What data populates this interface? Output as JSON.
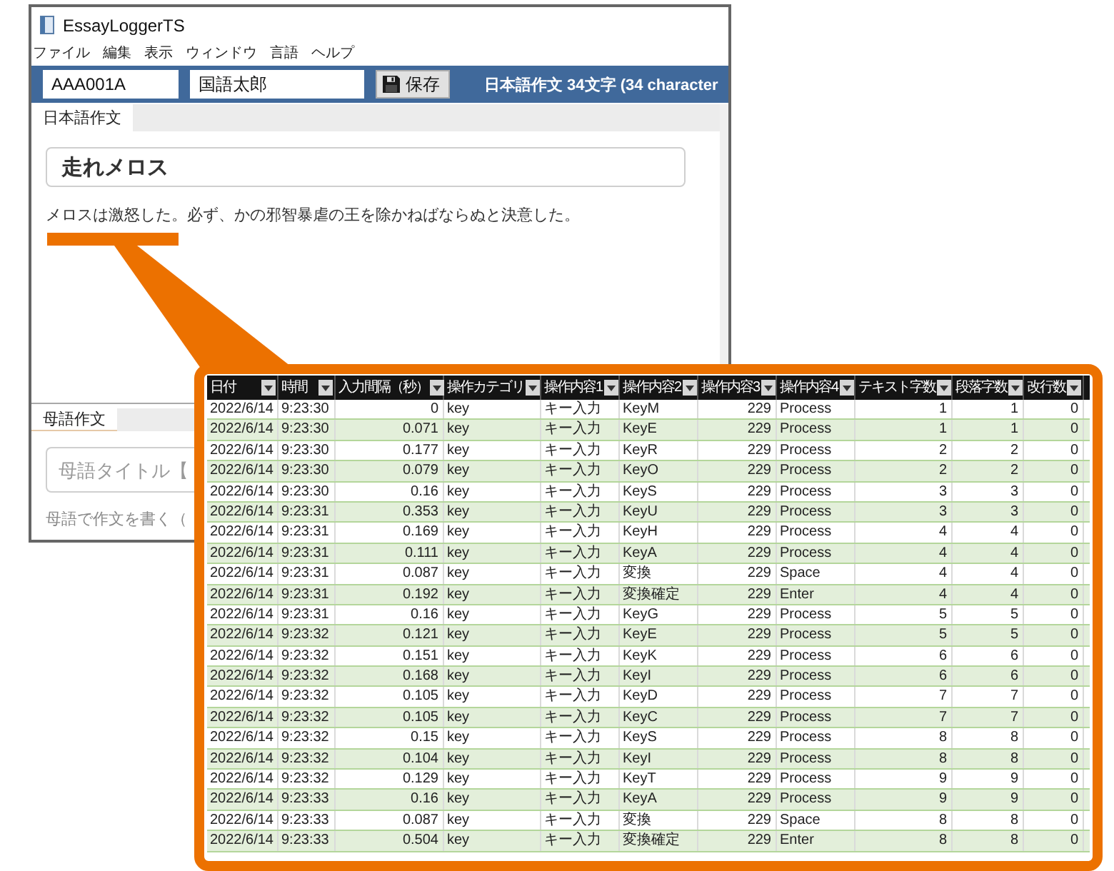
{
  "window": {
    "title": "EssayLoggerTS"
  },
  "menu": [
    "ファイル",
    "編集",
    "表示",
    "ウィンドウ",
    "言語",
    "ヘルプ"
  ],
  "toolbar": {
    "id_field": {
      "value": "AAA001A"
    },
    "name_field": {
      "value": "国語太郎"
    },
    "save_button": "保存",
    "status": "日本語作文 34文字 (34 character"
  },
  "japanese_pane": {
    "tabs": [
      {
        "label": "日本語作文",
        "selected": true
      }
    ],
    "title_field": {
      "value": "走れメロス"
    },
    "essay_field": {
      "value": "メロスは激怒した。必ず、かの邪智暴虐の王を除かねばならぬと決意した。"
    }
  },
  "native_pane": {
    "tabs": [
      {
        "label": "母語作文",
        "selected": true
      }
    ],
    "title_field": {
      "placeholder": "母語タイトル【"
    },
    "essay_field": {
      "placeholder": "母語で作文を書く（"
    }
  },
  "log_table": {
    "columns": [
      {
        "label": "日付",
        "kind": "text"
      },
      {
        "label": "時間",
        "kind": "text"
      },
      {
        "label": "入力間隔（秒）",
        "kind": "number"
      },
      {
        "label": "操作カテゴリ",
        "kind": "text"
      },
      {
        "label": "操作内容1",
        "kind": "text"
      },
      {
        "label": "操作内容2",
        "kind": "text"
      },
      {
        "label": "操作内容3",
        "kind": "number"
      },
      {
        "label": "操作内容4",
        "kind": "text"
      },
      {
        "label": "テキスト字数",
        "kind": "number"
      },
      {
        "label": "段落字数",
        "kind": "number"
      },
      {
        "label": "改行数",
        "kind": "number"
      }
    ],
    "rows": [
      [
        "2022/6/14",
        "9:23:30",
        "0",
        "key",
        "キー入力",
        "KeyM",
        "229",
        "Process",
        "1",
        "1",
        "0"
      ],
      [
        "2022/6/14",
        "9:23:30",
        "0.071",
        "key",
        "キー入力",
        "KeyE",
        "229",
        "Process",
        "1",
        "1",
        "0"
      ],
      [
        "2022/6/14",
        "9:23:30",
        "0.177",
        "key",
        "キー入力",
        "KeyR",
        "229",
        "Process",
        "2",
        "2",
        "0"
      ],
      [
        "2022/6/14",
        "9:23:30",
        "0.079",
        "key",
        "キー入力",
        "KeyO",
        "229",
        "Process",
        "2",
        "2",
        "0"
      ],
      [
        "2022/6/14",
        "9:23:30",
        "0.16",
        "key",
        "キー入力",
        "KeyS",
        "229",
        "Process",
        "3",
        "3",
        "0"
      ],
      [
        "2022/6/14",
        "9:23:31",
        "0.353",
        "key",
        "キー入力",
        "KeyU",
        "229",
        "Process",
        "3",
        "3",
        "0"
      ],
      [
        "2022/6/14",
        "9:23:31",
        "0.169",
        "key",
        "キー入力",
        "KeyH",
        "229",
        "Process",
        "4",
        "4",
        "0"
      ],
      [
        "2022/6/14",
        "9:23:31",
        "0.111",
        "key",
        "キー入力",
        "KeyA",
        "229",
        "Process",
        "4",
        "4",
        "0"
      ],
      [
        "2022/6/14",
        "9:23:31",
        "0.087",
        "key",
        "キー入力",
        "変換",
        "229",
        "Space",
        "4",
        "4",
        "0"
      ],
      [
        "2022/6/14",
        "9:23:31",
        "0.192",
        "key",
        "キー入力",
        "変換確定",
        "229",
        "Enter",
        "4",
        "4",
        "0"
      ],
      [
        "2022/6/14",
        "9:23:31",
        "0.16",
        "key",
        "キー入力",
        "KeyG",
        "229",
        "Process",
        "5",
        "5",
        "0"
      ],
      [
        "2022/6/14",
        "9:23:32",
        "0.121",
        "key",
        "キー入力",
        "KeyE",
        "229",
        "Process",
        "5",
        "5",
        "0"
      ],
      [
        "2022/6/14",
        "9:23:32",
        "0.151",
        "key",
        "キー入力",
        "KeyK",
        "229",
        "Process",
        "6",
        "6",
        "0"
      ],
      [
        "2022/6/14",
        "9:23:32",
        "0.168",
        "key",
        "キー入力",
        "KeyI",
        "229",
        "Process",
        "6",
        "6",
        "0"
      ],
      [
        "2022/6/14",
        "9:23:32",
        "0.105",
        "key",
        "キー入力",
        "KeyD",
        "229",
        "Process",
        "7",
        "7",
        "0"
      ],
      [
        "2022/6/14",
        "9:23:32",
        "0.105",
        "key",
        "キー入力",
        "KeyC",
        "229",
        "Process",
        "7",
        "7",
        "0"
      ],
      [
        "2022/6/14",
        "9:23:32",
        "0.15",
        "key",
        "キー入力",
        "KeyS",
        "229",
        "Process",
        "8",
        "8",
        "0"
      ],
      [
        "2022/6/14",
        "9:23:32",
        "0.104",
        "key",
        "キー入力",
        "KeyI",
        "229",
        "Process",
        "8",
        "8",
        "0"
      ],
      [
        "2022/6/14",
        "9:23:32",
        "0.129",
        "key",
        "キー入力",
        "KeyT",
        "229",
        "Process",
        "9",
        "9",
        "0"
      ],
      [
        "2022/6/14",
        "9:23:33",
        "0.16",
        "key",
        "キー入力",
        "KeyA",
        "229",
        "Process",
        "9",
        "9",
        "0"
      ],
      [
        "2022/6/14",
        "9:23:33",
        "0.087",
        "key",
        "キー入力",
        "変換",
        "229",
        "Space",
        "8",
        "8",
        "0"
      ],
      [
        "2022/6/14",
        "9:23:33",
        "0.504",
        "key",
        "キー入力",
        "変換確定",
        "229",
        "Enter",
        "8",
        "8",
        "0"
      ]
    ]
  }
}
